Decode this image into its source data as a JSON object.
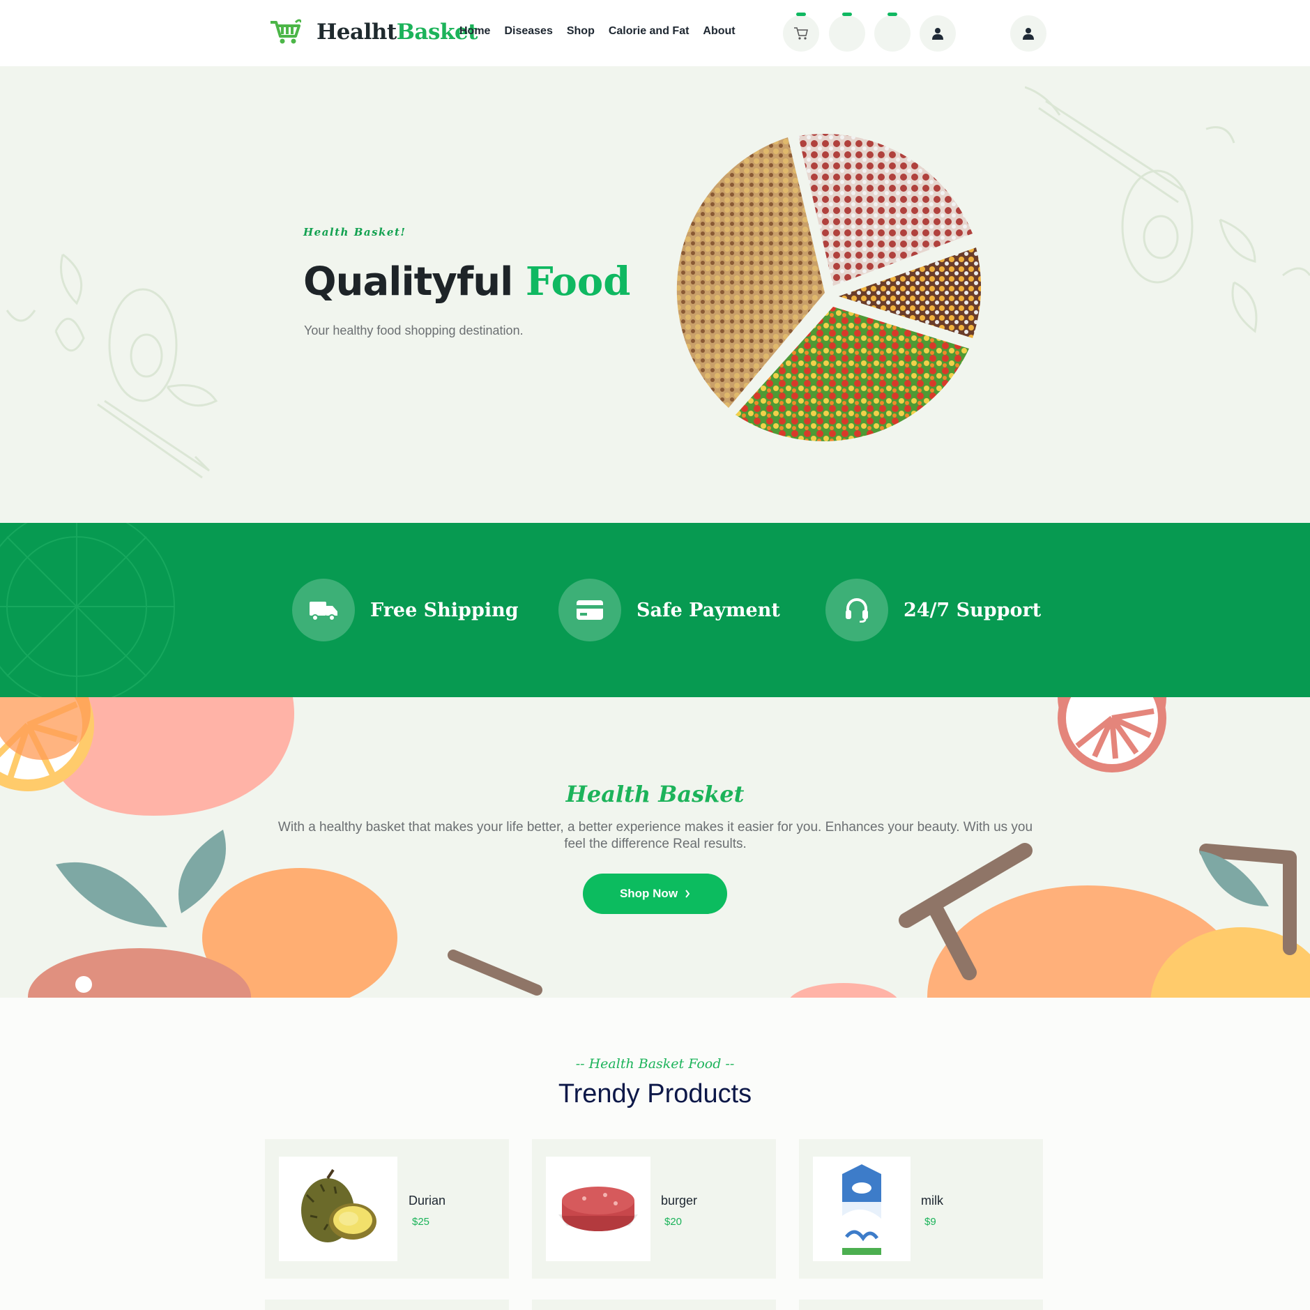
{
  "brand": {
    "name_part1": "Healht",
    "name_part2": "Basket"
  },
  "nav": [
    {
      "label": "Home"
    },
    {
      "label": "Diseases"
    },
    {
      "label": "Shop"
    },
    {
      "label": "Calorie and Fat"
    },
    {
      "label": "About"
    }
  ],
  "header_icons": [
    "cart-icon",
    "wishlist-icon",
    "compare-icon",
    "user-icon",
    "account-icon"
  ],
  "hero": {
    "subtitle": "Health Basket!",
    "title_dark": "Qualityful",
    "title_green": "Food",
    "description": "Your healthy food shopping destination."
  },
  "features": [
    {
      "label": "Free Shipping",
      "icon": "truck-icon"
    },
    {
      "label": "Safe Payment",
      "icon": "credit-card-icon"
    },
    {
      "label": "24/7 Support",
      "icon": "headset-icon"
    }
  ],
  "about": {
    "title": "Health Basket",
    "text": "With a healthy basket that makes your life better, a better experience makes it easier for you. Enhances your beauty. With us you feel the difference Real results.",
    "button_label": "Shop Now",
    "button_icon": "chevron-right-icon"
  },
  "products_section": {
    "subtitle": "-- Health Basket Food --",
    "title": "Trendy Products"
  },
  "products": [
    {
      "name": "Durian",
      "price": "$25"
    },
    {
      "name": "burger",
      "price": "$20"
    },
    {
      "name": "milk",
      "price": "$9"
    }
  ],
  "colors": {
    "brand_green": "#0fb861",
    "band_green": "#079a51",
    "hero_bg": "#f1f5ee",
    "heading_navy": "#0d1848"
  }
}
